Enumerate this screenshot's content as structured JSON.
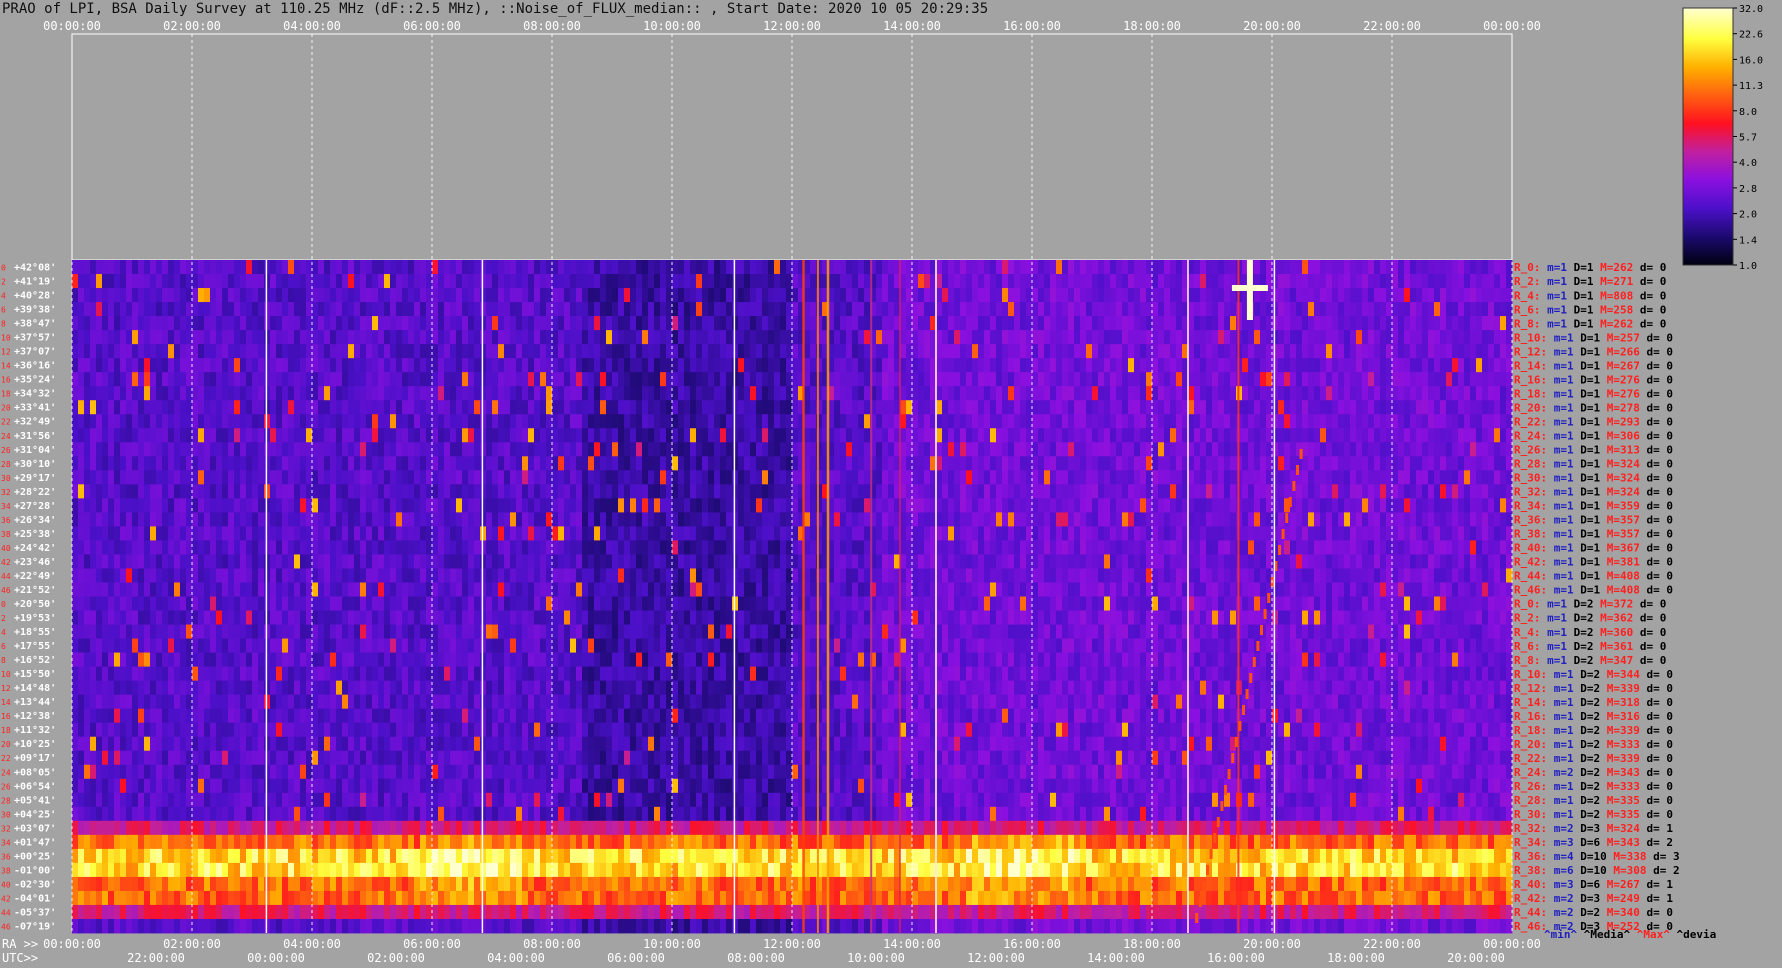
{
  "title": "PRAO of LPI, BSA Daily Survey at 110.25 MHz (dF::2.5 MHz), ::Noise_of_FLUX_median:: , Start Date: 2020 10 05 20:29:35",
  "axis_labels": {
    "ra_prefix": "RA >>",
    "utc_prefix": "UTC>>"
  },
  "legend": {
    "min": "^min^",
    "median": "^Media^",
    "max": "^Max^",
    "devia": "^devia"
  },
  "colors": {
    "min": "#2020c0",
    "median": "#000000",
    "max": "#ff2020",
    "devia": "#000000"
  },
  "chart_data": {
    "type": "heatmap",
    "title": "PRAO of LPI, BSA Daily Survey at 110.25 MHz (dF::2.5 MHz), ::Noise_of_FLUX_median:: , Start Date: 2020 10 05 20:29:35",
    "ra_top_ticks": [
      "00:00:00",
      "02:00:00",
      "04:00:00",
      "06:00:00",
      "08:00:00",
      "10:00:00",
      "12:00:00",
      "14:00:00",
      "16:00:00",
      "18:00:00",
      "20:00:00",
      "22:00:00",
      "00:00:00"
    ],
    "ra_bottom_ticks": [
      "00:00:00",
      "02:00:00",
      "04:00:00",
      "06:00:00",
      "08:00:00",
      "10:00:00",
      "12:00:00",
      "14:00:00",
      "16:00:00",
      "18:00:00",
      "20:00:00",
      "22:00:00",
      "00:00:00"
    ],
    "utc_ticks": [
      "22:00:00",
      "00:00:00",
      "02:00:00",
      "04:00:00",
      "06:00:00",
      "08:00:00",
      "10:00:00",
      "12:00:00",
      "14:00:00",
      "16:00:00",
      "18:00:00",
      "20:00:00"
    ],
    "declinations": [
      "+42°08'",
      "+41°19'",
      "+40°28'",
      "+39°38'",
      "+38°47'",
      "+37°57'",
      "+37°07'",
      "+36°16'",
      "+35°24'",
      "+34°32'",
      "+33°41'",
      "+32°49'",
      "+31°56'",
      "+31°04'",
      "+30°10'",
      "+29°17'",
      "+28°22'",
      "+27°28'",
      "+26°34'",
      "+25°38'",
      "+24°42'",
      "+23°46'",
      "+22°49'",
      "+21°52'",
      "+20°50'",
      "+19°53'",
      "+18°55'",
      "+17°55'",
      "+16°52'",
      "+15°50'",
      "+14°48'",
      "+13°44'",
      "+12°38'",
      "+11°32'",
      "+10°25'",
      "+09°17'",
      "+08°05'",
      "+06°54'",
      "+05°41'",
      "+04°25'",
      "+03°07'",
      "+01°47'",
      "+00°25'",
      "-01°00'",
      "-02°30'",
      "-04°01'",
      "-05°37'",
      "-07°19'"
    ],
    "row_indices": [
      "0",
      "2",
      "4",
      "6",
      "8",
      "10",
      "12",
      "14",
      "16",
      "18",
      "20",
      "22",
      "24",
      "26",
      "28",
      "30",
      "32",
      "34",
      "36",
      "38",
      "40",
      "42",
      "44",
      "46",
      "0",
      "2",
      "4",
      "6",
      "8",
      "10",
      "12",
      "14",
      "16",
      "18",
      "20",
      "22",
      "24",
      "26",
      "28",
      "30",
      "32",
      "34",
      "36",
      "38",
      "40",
      "42",
      "44",
      "46"
    ],
    "row_stats": [
      {
        "r": "R_0:",
        "m": "m=1",
        "D": "D=1",
        "M": "M=262",
        "d": "d= 0"
      },
      {
        "r": "R_2:",
        "m": "m=1",
        "D": "D=1",
        "M": "M=271",
        "d": "d= 0"
      },
      {
        "r": "R_4:",
        "m": "m=1",
        "D": "D=1",
        "M": "M=808",
        "d": "d= 0"
      },
      {
        "r": "R_6:",
        "m": "m=1",
        "D": "D=1",
        "M": "M=258",
        "d": "d= 0"
      },
      {
        "r": "R_8:",
        "m": "m=1",
        "D": "D=1",
        "M": "M=262",
        "d": "d= 0"
      },
      {
        "r": "R_10:",
        "m": "m=1",
        "D": "D=1",
        "M": "M=257",
        "d": "d= 0"
      },
      {
        "r": "R_12:",
        "m": "m=1",
        "D": "D=1",
        "M": "M=266",
        "d": "d= 0"
      },
      {
        "r": "R_14:",
        "m": "m=1",
        "D": "D=1",
        "M": "M=267",
        "d": "d= 0"
      },
      {
        "r": "R_16:",
        "m": "m=1",
        "D": "D=1",
        "M": "M=276",
        "d": "d= 0"
      },
      {
        "r": "R_18:",
        "m": "m=1",
        "D": "D=1",
        "M": "M=276",
        "d": "d= 0"
      },
      {
        "r": "R_20:",
        "m": "m=1",
        "D": "D=1",
        "M": "M=278",
        "d": "d= 0"
      },
      {
        "r": "R_22:",
        "m": "m=1",
        "D": "D=1",
        "M": "M=293",
        "d": "d= 0"
      },
      {
        "r": "R_24:",
        "m": "m=1",
        "D": "D=1",
        "M": "M=306",
        "d": "d= 0"
      },
      {
        "r": "R_26:",
        "m": "m=1",
        "D": "D=1",
        "M": "M=313",
        "d": "d= 0"
      },
      {
        "r": "R_28:",
        "m": "m=1",
        "D": "D=1",
        "M": "M=324",
        "d": "d= 0"
      },
      {
        "r": "R_30:",
        "m": "m=1",
        "D": "D=1",
        "M": "M=324",
        "d": "d= 0"
      },
      {
        "r": "R_32:",
        "m": "m=1",
        "D": "D=1",
        "M": "M=324",
        "d": "d= 0"
      },
      {
        "r": "R_34:",
        "m": "m=1",
        "D": "D=1",
        "M": "M=359",
        "d": "d= 0"
      },
      {
        "r": "R_36:",
        "m": "m=1",
        "D": "D=1",
        "M": "M=357",
        "d": "d= 0"
      },
      {
        "r": "R_38:",
        "m": "m=1",
        "D": "D=1",
        "M": "M=357",
        "d": "d= 0"
      },
      {
        "r": "R_40:",
        "m": "m=1",
        "D": "D=1",
        "M": "M=367",
        "d": "d= 0"
      },
      {
        "r": "R_42:",
        "m": "m=1",
        "D": "D=1",
        "M": "M=381",
        "d": "d= 0"
      },
      {
        "r": "R_44:",
        "m": "m=1",
        "D": "D=1",
        "M": "M=408",
        "d": "d= 0"
      },
      {
        "r": "R_46:",
        "m": "m=1",
        "D": "D=1",
        "M": "M=408",
        "d": "d= 0"
      },
      {
        "r": "R_0:",
        "m": "m=1",
        "D": "D=2",
        "M": "M=372",
        "d": "d= 0"
      },
      {
        "r": "R_2:",
        "m": "m=1",
        "D": "D=2",
        "M": "M=362",
        "d": "d= 0"
      },
      {
        "r": "R_4:",
        "m": "m=1",
        "D": "D=2",
        "M": "M=360",
        "d": "d= 0"
      },
      {
        "r": "R_6:",
        "m": "m=1",
        "D": "D=2",
        "M": "M=361",
        "d": "d= 0"
      },
      {
        "r": "R_8:",
        "m": "m=1",
        "D": "D=2",
        "M": "M=347",
        "d": "d= 0"
      },
      {
        "r": "R_10:",
        "m": "m=1",
        "D": "D=2",
        "M": "M=344",
        "d": "d= 0"
      },
      {
        "r": "R_12:",
        "m": "m=1",
        "D": "D=2",
        "M": "M=339",
        "d": "d= 0"
      },
      {
        "r": "R_14:",
        "m": "m=1",
        "D": "D=2",
        "M": "M=318",
        "d": "d= 0"
      },
      {
        "r": "R_16:",
        "m": "m=1",
        "D": "D=2",
        "M": "M=316",
        "d": "d= 0"
      },
      {
        "r": "R_18:",
        "m": "m=1",
        "D": "D=2",
        "M": "M=339",
        "d": "d= 0"
      },
      {
        "r": "R_20:",
        "m": "m=1",
        "D": "D=2",
        "M": "M=333",
        "d": "d= 0"
      },
      {
        "r": "R_22:",
        "m": "m=1",
        "D": "D=2",
        "M": "M=339",
        "d": "d= 0"
      },
      {
        "r": "R_24:",
        "m": "m=2",
        "D": "D=2",
        "M": "M=343",
        "d": "d= 0"
      },
      {
        "r": "R_26:",
        "m": "m=1",
        "D": "D=2",
        "M": "M=333",
        "d": "d= 0"
      },
      {
        "r": "R_28:",
        "m": "m=1",
        "D": "D=2",
        "M": "M=335",
        "d": "d= 0"
      },
      {
        "r": "R_30:",
        "m": "m=1",
        "D": "D=2",
        "M": "M=335",
        "d": "d= 0"
      },
      {
        "r": "R_32:",
        "m": "m=2",
        "D": "D=3",
        "M": "M=324",
        "d": "d= 1"
      },
      {
        "r": "R_34:",
        "m": "m=3",
        "D": "D=6",
        "M": "M=343",
        "d": "d= 2"
      },
      {
        "r": "R_36:",
        "m": "m=4",
        "D": "D=10",
        "M": "M=338",
        "d": "d= 3"
      },
      {
        "r": "R_38:",
        "m": "m=6",
        "D": "D=10",
        "M": "M=308",
        "d": "d= 2"
      },
      {
        "r": "R_40:",
        "m": "m=3",
        "D": "D=6",
        "M": "M=267",
        "d": "d= 1"
      },
      {
        "r": "R_42:",
        "m": "m=2",
        "D": "D=3",
        "M": "M=249",
        "d": "d= 1"
      },
      {
        "r": "R_44:",
        "m": "m=2",
        "D": "D=2",
        "M": "M=340",
        "d": "d= 0"
      },
      {
        "r": "R_46:",
        "m": "m=2",
        "D": "D=3",
        "M": "M=252",
        "d": "d= 0"
      }
    ],
    "colorbar": {
      "ticks": [
        "32.0",
        "22.6",
        "16.0",
        "11.3",
        "8.0",
        "5.7",
        "4.0",
        "2.8",
        "2.0",
        "1.4",
        "1.0"
      ],
      "scale": "log",
      "range": [
        1.0,
        32.0
      ],
      "colors": [
        "#000010",
        "#1c0a70",
        "#4b10c8",
        "#8a10e0",
        "#c020a0",
        "#ff1020",
        "#ff6010",
        "#ffb000",
        "#ffff40",
        "#ffffd0"
      ]
    },
    "grid": true
  }
}
